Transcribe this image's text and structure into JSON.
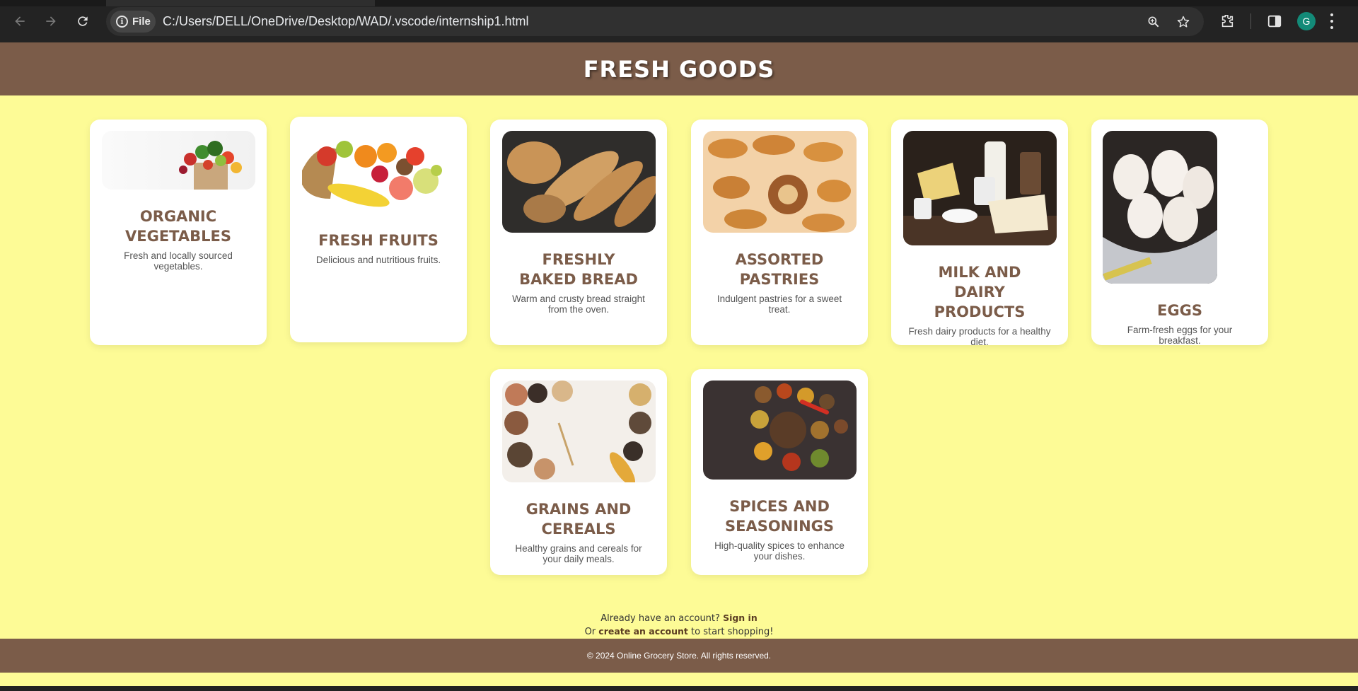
{
  "browser": {
    "file_chip_label": "File",
    "url": "C:/Users/DELL/OneDrive/Desktop/WAD/.vscode/internship1.html",
    "profile_initial": "G",
    "icons": [
      "back-arrow-icon",
      "forward-arrow-icon",
      "reload-icon",
      "info-icon",
      "zoom-icon",
      "star-icon",
      "extensions-icon",
      "side-panel-icon",
      "menu-icon"
    ]
  },
  "site": {
    "title": "FRESH GOODS"
  },
  "products": [
    {
      "title": "Organic Vegetables",
      "description": "Fresh and locally sourced vegetables.",
      "image": "vegetables-image"
    },
    {
      "title": "Fresh Fruits",
      "description": "Delicious and nutritious fruits.",
      "image": "fruits-image"
    },
    {
      "title": "Freshly Baked Bread",
      "description": "Warm and crusty bread straight from the oven.",
      "image": "bread-image"
    },
    {
      "title": "Assorted Pastries",
      "description": "Indulgent pastries for a sweet treat.",
      "image": "pastries-image"
    },
    {
      "title": "Milk and Dairy Products",
      "description": "Fresh dairy products for a healthy diet.",
      "image": "dairy-image"
    },
    {
      "title": "Eggs",
      "description": "Farm-fresh eggs for your breakfast.",
      "image": "eggs-image"
    },
    {
      "title": "Grains and Cereals",
      "description": "Healthy grains and cereals for your daily meals.",
      "image": "grains-image"
    },
    {
      "title": "Spices and Seasonings",
      "description": "High-quality spices to enhance your dishes.",
      "image": "spices-image"
    }
  ],
  "auth": {
    "line1_prefix": "Already have an account?",
    "signin_link": "Sign in",
    "line2_prefix": "Or",
    "create_link": "create an account",
    "line2_suffix": "to start shopping!"
  },
  "footer": {
    "copyright": "© 2024 Online Grocery Store. All rights reserved."
  },
  "colors": {
    "page_bg": "#fdfb96",
    "header_bg": "#7b5c49",
    "card_title": "#7b5c49",
    "card_bg": "#ffffff"
  }
}
